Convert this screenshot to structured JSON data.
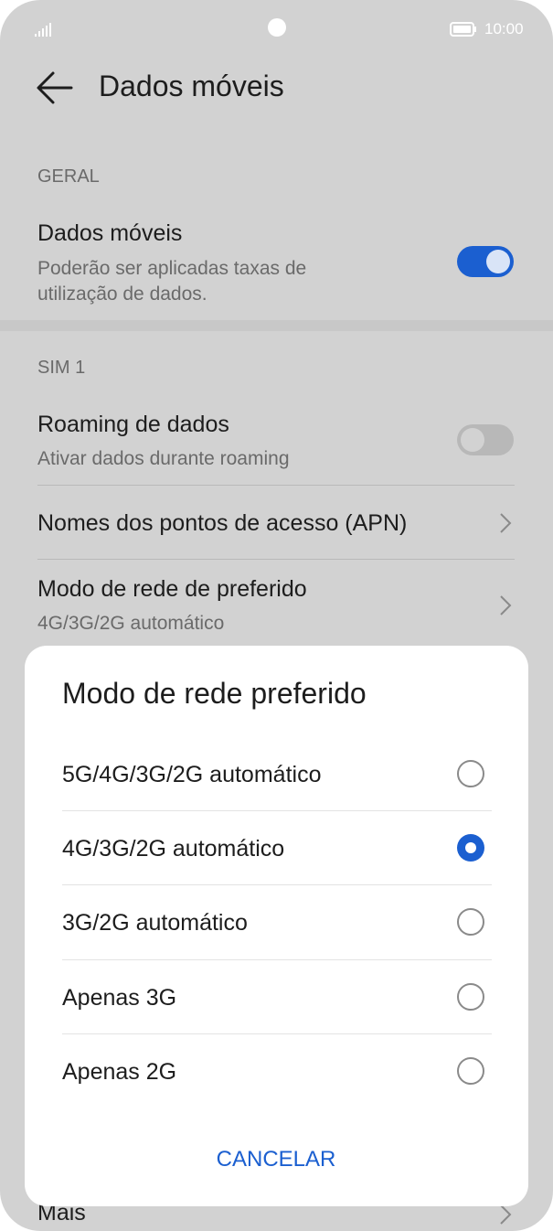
{
  "status_bar": {
    "time": "10:00",
    "signal_icon": "signal-icon",
    "battery_icon": "battery-icon"
  },
  "header": {
    "title": "Dados móveis",
    "back_icon": "back-arrow-icon"
  },
  "sections": {
    "geral": {
      "label": "GERAL",
      "mobile_data": {
        "title": "Dados móveis",
        "subtitle": "Poderão ser aplicadas taxas de utilização de dados.",
        "enabled": true
      }
    },
    "sim1": {
      "label": "SIM 1",
      "roaming": {
        "title": "Roaming de dados",
        "subtitle": "Ativar dados durante roaming",
        "enabled": false
      },
      "apn": {
        "title": "Nomes dos pontos de acesso (APN)"
      },
      "network_mode": {
        "title": "Modo de rede de preferido",
        "subtitle": "4G/3G/2G automático"
      }
    },
    "more": {
      "title": "Mais"
    }
  },
  "dialog": {
    "title": "Modo de rede preferido",
    "options": [
      {
        "label": "5G/4G/3G/2G automático",
        "selected": false
      },
      {
        "label": "4G/3G/2G automático",
        "selected": true
      },
      {
        "label": "3G/2G automático",
        "selected": false
      },
      {
        "label": "Apenas 3G",
        "selected": false
      },
      {
        "label": "Apenas 2G",
        "selected": false
      }
    ],
    "cancel_label": "CANCELAR"
  },
  "colors": {
    "accent": "#1b5fd0",
    "scrim_bg": "#d2d2d2",
    "dialog_bg": "#ffffff"
  }
}
